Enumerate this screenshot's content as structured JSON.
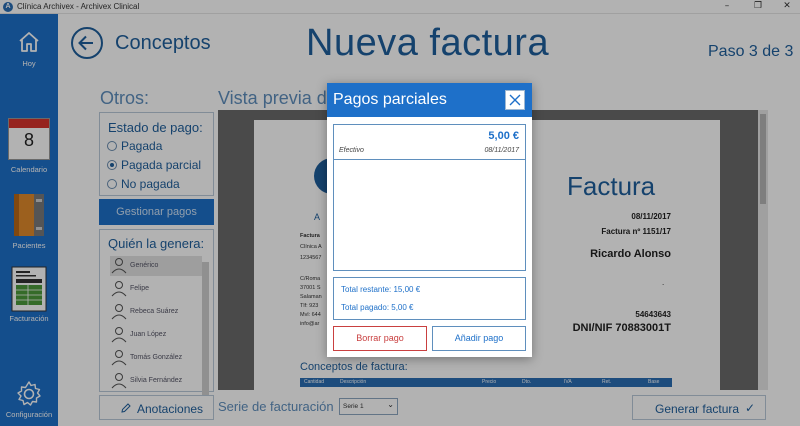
{
  "window": {
    "title": "Clínica Archivex - Archivex Clinical",
    "minimize": "–",
    "maximize": "❐",
    "close": "✕"
  },
  "sidebar": {
    "items": [
      {
        "label": "Hoy",
        "icon": "home-icon"
      },
      {
        "label": "Calendario",
        "icon": "calendar-icon",
        "day": "8"
      },
      {
        "label": "Pacientes",
        "icon": "patients-binder-icon"
      },
      {
        "label": "Facturación",
        "icon": "invoice-icon"
      },
      {
        "label": "Configuración",
        "icon": "gear-icon"
      }
    ]
  },
  "header": {
    "back_label": "Conceptos",
    "title": "Nueva factura",
    "step": "Paso 3 de 3"
  },
  "sections": {
    "otros": "Otros:",
    "vista": "Vista previa de"
  },
  "estado_pago": {
    "title": "Estado de pago:",
    "options": [
      "Pagada",
      "Pagada parcial",
      "No pagada"
    ],
    "selected": "Pagada parcial"
  },
  "gestionar_pagos": "Gestionar pagos",
  "quien": {
    "title": "Quién la genera:",
    "people": [
      "Genérico",
      "Felipe",
      "Rebeca Suárez",
      "Juan López",
      "Tomás González",
      "Silvia Fernández"
    ],
    "selected": "Genérico"
  },
  "invoice_preview": {
    "title": "Factura",
    "date": "08/11/2017",
    "number": "Factura nº 1151/17",
    "client": "Ricardo Alonso",
    "dot": ".",
    "code": "54643643",
    "dni": "DNI/NIF 70883001T",
    "clinic_lines": [
      "Factura",
      "Clínica A",
      "1234567"
    ],
    "address_lines": [
      "C/Roma",
      "37001 S",
      "Salaman",
      "Tlf: 923",
      "Mvl: 644",
      "info@ar"
    ],
    "logo_letter": "A",
    "conceptos": "Conceptos de factura:",
    "columns": [
      "Cantidad",
      "Descripción",
      "Precio",
      "Dto.",
      "IVA",
      "Ret.",
      "Base"
    ]
  },
  "footer": {
    "anotaciones": "Anotaciones",
    "serie_label": "Serie de facturación",
    "serie_value": "Serie 1",
    "generar": "Generar factura"
  },
  "modal": {
    "title": "Pagos parciales",
    "payments": [
      {
        "amount": "5,00 €",
        "method": "Efectivo",
        "date": "08/11/2017"
      }
    ],
    "total_restante": "Total restante: 15,00 €",
    "total_pagado": "Total pagado: 5,00 €",
    "borrar": "Borrar pago",
    "anadir": "Añadir pago"
  },
  "colors": {
    "accent": "#1e70c9",
    "text": "#1f5f9c",
    "danger": "#c94040"
  }
}
